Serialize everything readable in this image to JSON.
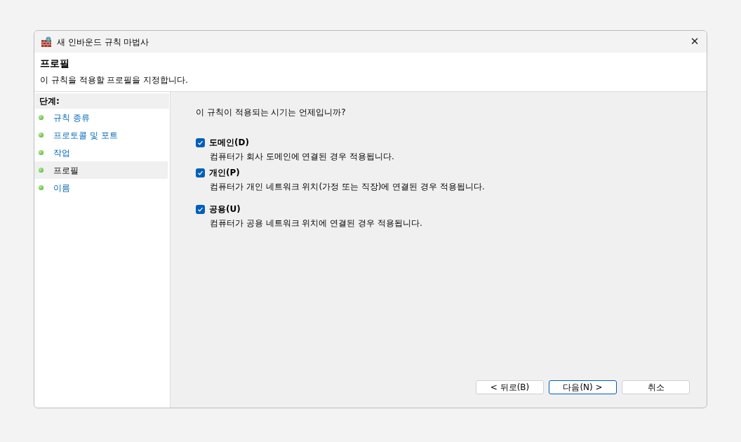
{
  "window": {
    "title": "새 인바운드 규칙 마법사",
    "close": "✕"
  },
  "header": {
    "title": "프로필",
    "description": "이 규칙을 적용할 프로필을 지정합니다."
  },
  "steps": {
    "heading": "단계:",
    "items": [
      {
        "label": "규칙 종류",
        "selected": false
      },
      {
        "label": "프로토콜 및 포트",
        "selected": false
      },
      {
        "label": "작업",
        "selected": false
      },
      {
        "label": "프로필",
        "selected": true
      },
      {
        "label": "이름",
        "selected": false
      }
    ]
  },
  "question": "이 규칙이 적용되는 시기는 언제입니까?",
  "profiles": [
    {
      "label": "도메인(D)",
      "description": "컴퓨터가 회사 도메인에 연결된 경우 적용됩니다.",
      "checked": true
    },
    {
      "label": "개인(P)",
      "description": "컴퓨터가 개인 네트워크 위치(가정 또는 직장)에 연결된 경우 적용됩니다.",
      "checked": true
    },
    {
      "label": "공용(U)",
      "description": "컴퓨터가 공용 네트워크 위치에 연결된 경우 적용됩니다.",
      "checked": true
    }
  ],
  "buttons": [
    {
      "label": "< 뒤로(B)",
      "default": false
    },
    {
      "label": "다음(N) >",
      "default": true
    },
    {
      "label": "취소",
      "default": false
    }
  ]
}
